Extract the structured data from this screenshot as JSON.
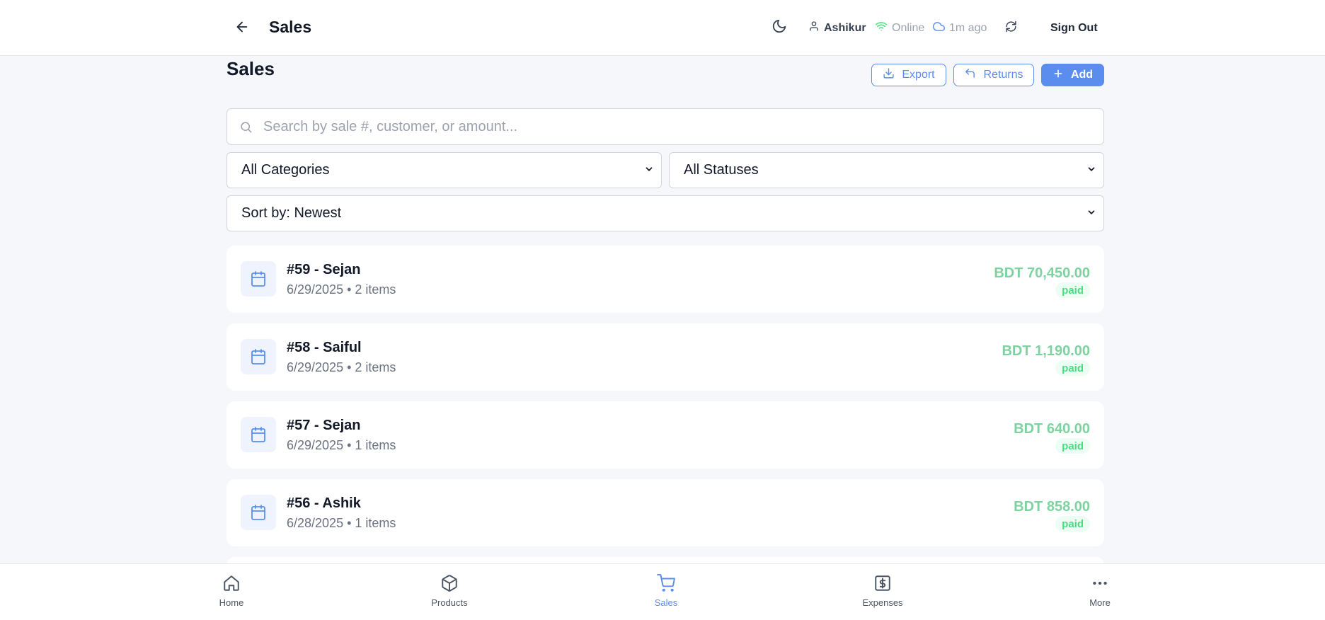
{
  "header": {
    "title": "Sales",
    "user": "Ashikur",
    "connection": "Online",
    "last_sync": "1m ago",
    "sign_out": "Sign Out"
  },
  "page": {
    "title": "Sales",
    "export_label": "Export",
    "returns_label": "Returns",
    "add_label": "Add"
  },
  "search": {
    "placeholder": "Search by sale #, customer, or amount...",
    "value": ""
  },
  "filters": {
    "category": "All Categories",
    "status": "All Statuses",
    "sort": "Sort by: Newest"
  },
  "sales": [
    {
      "title": "#59 - Sejan",
      "subtitle": "6/29/2025 • 2 items",
      "amount": "BDT 70,450.00",
      "status": "paid"
    },
    {
      "title": "#58 - Saiful",
      "subtitle": "6/29/2025 • 2 items",
      "amount": "BDT 1,190.00",
      "status": "paid"
    },
    {
      "title": "#57 - Sejan",
      "subtitle": "6/29/2025 • 1 items",
      "amount": "BDT 640.00",
      "status": "paid"
    },
    {
      "title": "#56 - Ashik",
      "subtitle": "6/28/2025 • 1 items",
      "amount": "BDT 858.00",
      "status": "paid"
    }
  ],
  "nav": [
    {
      "label": "Home",
      "icon": "home-icon"
    },
    {
      "label": "Products",
      "icon": "box-icon"
    },
    {
      "label": "Sales",
      "icon": "cart-icon",
      "active": true
    },
    {
      "label": "Expenses",
      "icon": "dollar-receipt-icon"
    },
    {
      "label": "More",
      "icon": "more-icon"
    }
  ],
  "colors": {
    "accent": "#5b8def",
    "paid_text": "#4ade80",
    "paid_bg": "#ecfdf3",
    "amount": "#7dd3a0",
    "online": "#4ade80"
  }
}
